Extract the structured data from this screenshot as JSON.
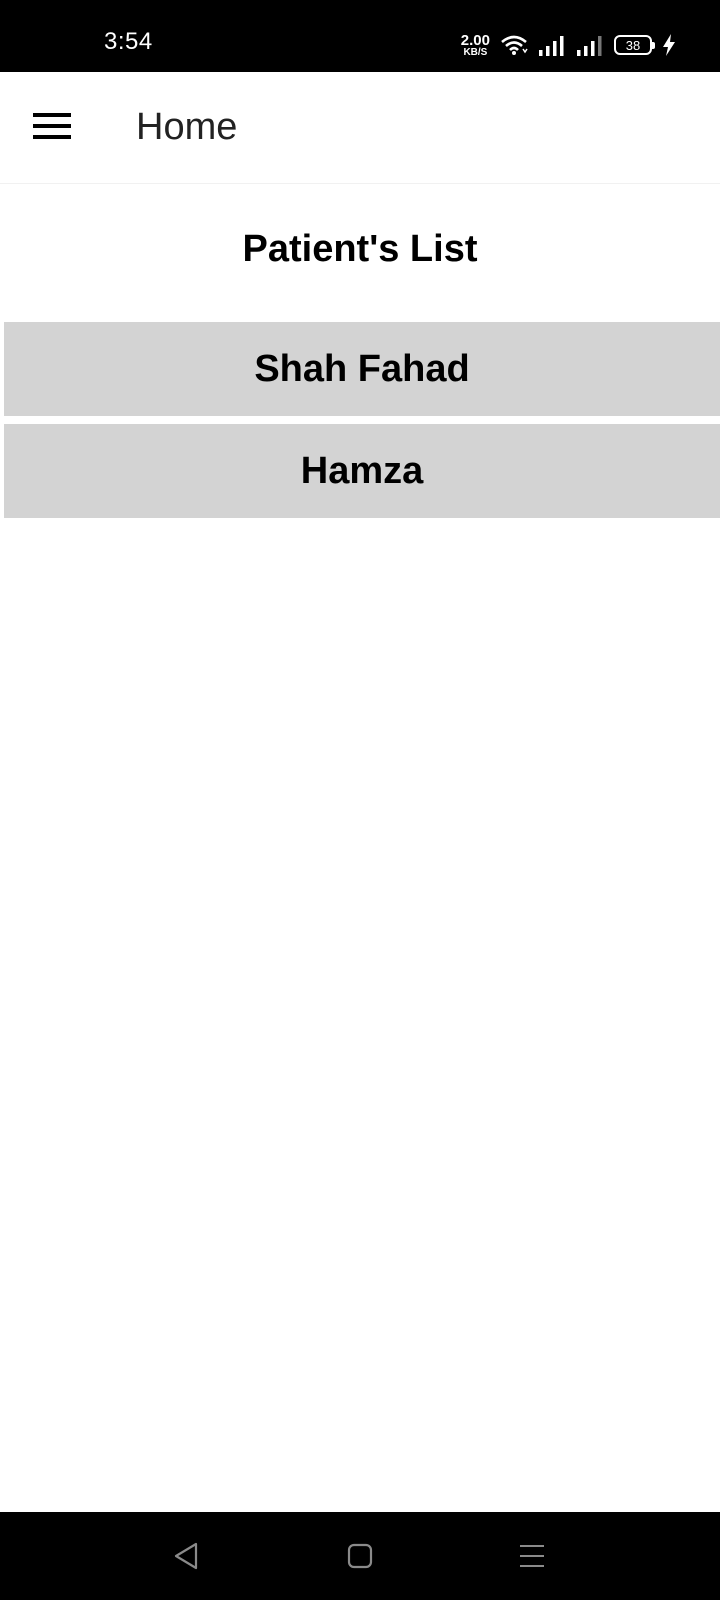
{
  "status_bar": {
    "time": "3:54",
    "net_speed_value": "2.00",
    "net_speed_unit": "KB/S",
    "battery_level": "38",
    "icons": [
      "wifi-icon",
      "signal-icon",
      "signal-icon",
      "battery-icon",
      "charging-icon"
    ]
  },
  "app_bar": {
    "title": "Home",
    "menu_icon": "hamburger-menu-icon"
  },
  "patients": {
    "heading": "Patient's List",
    "items": [
      "Shah Fahad",
      "Hamza"
    ]
  },
  "nav_bar": {
    "icons": [
      "back-icon",
      "home-icon",
      "recents-icon"
    ]
  },
  "colors": {
    "status_bar_bg": "#000000",
    "list_item_bg": "#d3d3d3",
    "text": "#000000"
  }
}
